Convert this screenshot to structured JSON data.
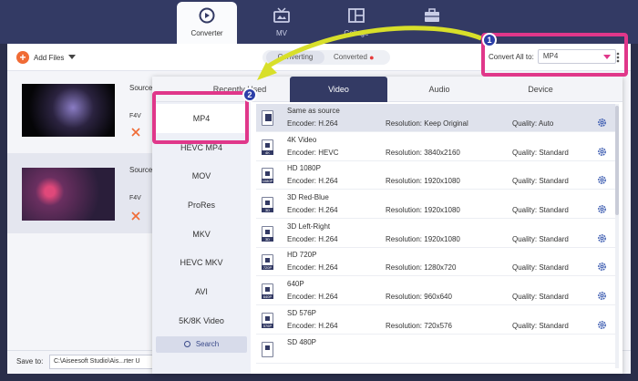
{
  "nav": {
    "tabs": [
      {
        "label": "Converter",
        "icon": "converter-icon"
      },
      {
        "label": "MV",
        "icon": "tv-icon"
      },
      {
        "label": "Collage",
        "icon": "collage-icon"
      },
      {
        "label": "",
        "icon": "toolbox-icon"
      }
    ]
  },
  "toolbar": {
    "add_files": "Add Files",
    "seg_converting": "Converting",
    "seg_converted": "Converted",
    "convert_all_label": "Convert All to:",
    "convert_all_value": "MP4"
  },
  "files": [
    {
      "source": "Source",
      "format": "F4V"
    },
    {
      "source": "Source",
      "format": "F4V"
    }
  ],
  "footer": {
    "save_to": "Save to:",
    "path": "C:\\Aiseesoft Studio\\Ais...rter U"
  },
  "popup": {
    "tabs": [
      "Recently Used",
      "Video",
      "Audio",
      "Device"
    ],
    "active_tab": "Video",
    "side": [
      "MP4",
      "HEVC MP4",
      "MOV",
      "ProRes",
      "MKV",
      "HEVC MKV",
      "AVI",
      "5K/8K Video"
    ],
    "search": "Search",
    "items": [
      {
        "name": "Same as source",
        "encoder": "Encoder: H.264",
        "resolution": "Resolution: Keep Original",
        "quality": "Quality: Auto",
        "tag": ""
      },
      {
        "name": "4K Video",
        "encoder": "Encoder: HEVC",
        "resolution": "Resolution: 3840x2160",
        "quality": "Quality: Standard",
        "tag": "4K"
      },
      {
        "name": "HD 1080P",
        "encoder": "Encoder: H.264",
        "resolution": "Resolution: 1920x1080",
        "quality": "Quality: Standard",
        "tag": "1080P"
      },
      {
        "name": "3D Red-Blue",
        "encoder": "Encoder: H.264",
        "resolution": "Resolution: 1920x1080",
        "quality": "Quality: Standard",
        "tag": "3D"
      },
      {
        "name": "3D Left-Right",
        "encoder": "Encoder: H.264",
        "resolution": "Resolution: 1920x1080",
        "quality": "Quality: Standard",
        "tag": "3D"
      },
      {
        "name": "HD 720P",
        "encoder": "Encoder: H.264",
        "resolution": "Resolution: 1280x720",
        "quality": "Quality: Standard",
        "tag": "720P"
      },
      {
        "name": "640P",
        "encoder": "Encoder: H.264",
        "resolution": "Resolution: 960x640",
        "quality": "Quality: Standard",
        "tag": "640P"
      },
      {
        "name": "SD 576P",
        "encoder": "Encoder: H.264",
        "resolution": "Resolution: 720x576",
        "quality": "Quality: Standard",
        "tag": "576P"
      },
      {
        "name": "SD 480P",
        "encoder": "",
        "resolution": "",
        "quality": "",
        "tag": ""
      }
    ]
  },
  "annotations": {
    "badge1": "1",
    "badge2": "2"
  },
  "colors": {
    "accent": "#e0378a",
    "brand": "#333a64",
    "orange": "#f06b35",
    "badge": "#2c3fa8"
  }
}
